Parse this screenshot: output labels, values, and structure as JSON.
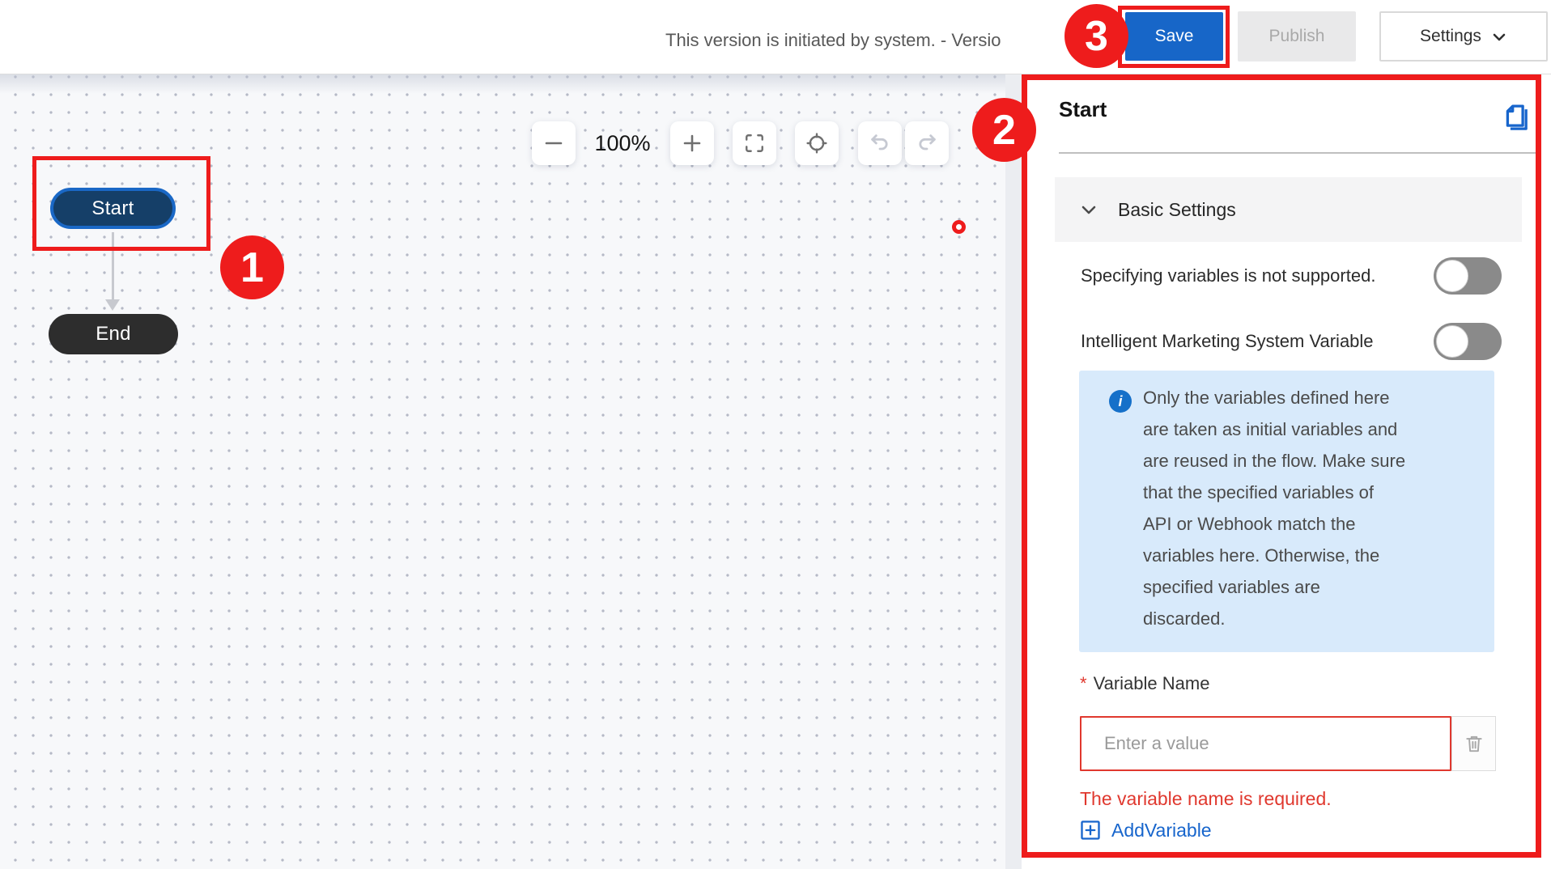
{
  "topbar": {
    "version_text": "This version is initiated by system. - Versio",
    "save_label": "Save",
    "publish_label": "Publish",
    "settings_label": "Settings"
  },
  "toolbar": {
    "zoom_level": "100%",
    "icons": [
      "zoom-out-minus",
      "zoom-in-plus",
      "fit-view-corners",
      "locate-crosshair",
      "undo-arrow",
      "redo-arrow"
    ]
  },
  "canvas": {
    "nodes": [
      {
        "id": "start",
        "label": "Start"
      },
      {
        "id": "end",
        "label": "End"
      }
    ],
    "start_label": "Start",
    "end_label": "End"
  },
  "annotations": {
    "step1": "1",
    "step2": "2",
    "step3": "3"
  },
  "panel": {
    "title": "Start",
    "header_icon": "copy-pages-icon",
    "basic_settings_label": "Basic Settings",
    "toggles": [
      {
        "label": "Specifying variables is not supported.",
        "state": "off"
      },
      {
        "label": "Intelligent Marketing System Variable",
        "state": "off"
      }
    ],
    "toggle1_label": "Specifying variables is not supported.",
    "toggle2_label": "Intelligent Marketing System Variable",
    "info_lines": [
      "Only the variables defined here",
      "are taken as initial variables and",
      "are reused in the flow. Make sure",
      "that the specified variables of",
      "API or Webhook match the",
      "variables here. Otherwise, the",
      "specified variables are",
      "discarded."
    ],
    "variable_field": {
      "required_marker": "*",
      "label": "Variable Name",
      "placeholder": "Enter a value",
      "error": "The variable name is required."
    },
    "add_variable_label": "AddVariable"
  },
  "colors": {
    "accent_blue": "#1766c8",
    "link_blue": "#1765cc",
    "annotation_red": "#ee1c1c",
    "error_red": "#e0382e",
    "info_bg": "#d8eafb",
    "info_icon_blue": "#1570c9",
    "start_node_fill": "#153f68",
    "start_node_border": "#1a68c6",
    "end_node_fill": "#2d2d2d",
    "toggle_track": "#8a8a8a",
    "canvas_bg": "#f7f8fa"
  }
}
